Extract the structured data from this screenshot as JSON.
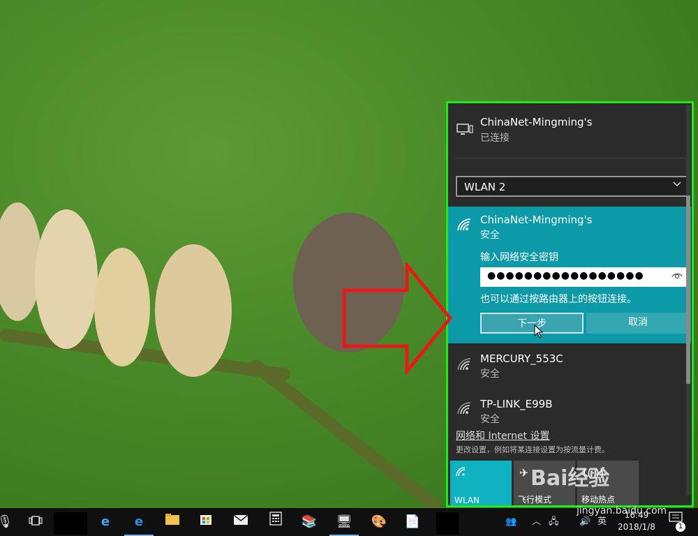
{
  "flyout": {
    "connected": {
      "name": "ChinaNet-Mingming's",
      "status": "已连接",
      "icon": "ethernet-monitor-icon"
    },
    "adapter": {
      "selected": "WLAN 2"
    },
    "expanded_network": {
      "name": "ChinaNet-Mingming's",
      "security": "安全",
      "prompt": "输入网络安全密钥",
      "password_dots": "●●●●●●●●●●●●●●●●●",
      "hint": "也可以通过按路由器上的按钮连接。",
      "next_label": "下一步",
      "cancel_label": "取消"
    },
    "networks": [
      {
        "name": "MERCURY_553C",
        "security": "安全"
      },
      {
        "name": "TP-LINK_E99B",
        "security": "安全"
      }
    ],
    "settings_link": "网络和 Internet 设置",
    "settings_desc": "更改设置，例如将某连接设置为按流量计费。",
    "tiles": [
      {
        "label": "WLAN",
        "active": true
      },
      {
        "label": "飞行模式",
        "active": false
      },
      {
        "label": "移动热点",
        "active": false
      }
    ]
  },
  "taskbar": {
    "tray": {
      "ime": "英",
      "time": "16:49",
      "date": "2018/1/8",
      "notif_count": "1"
    }
  },
  "watermark": {
    "brand": "Bai经验",
    "url": "jingyan.baidu.com"
  },
  "colors": {
    "accent": "#0c9aa8",
    "highlight_border": "#1fe81f",
    "arrow": "#e51b1b"
  }
}
